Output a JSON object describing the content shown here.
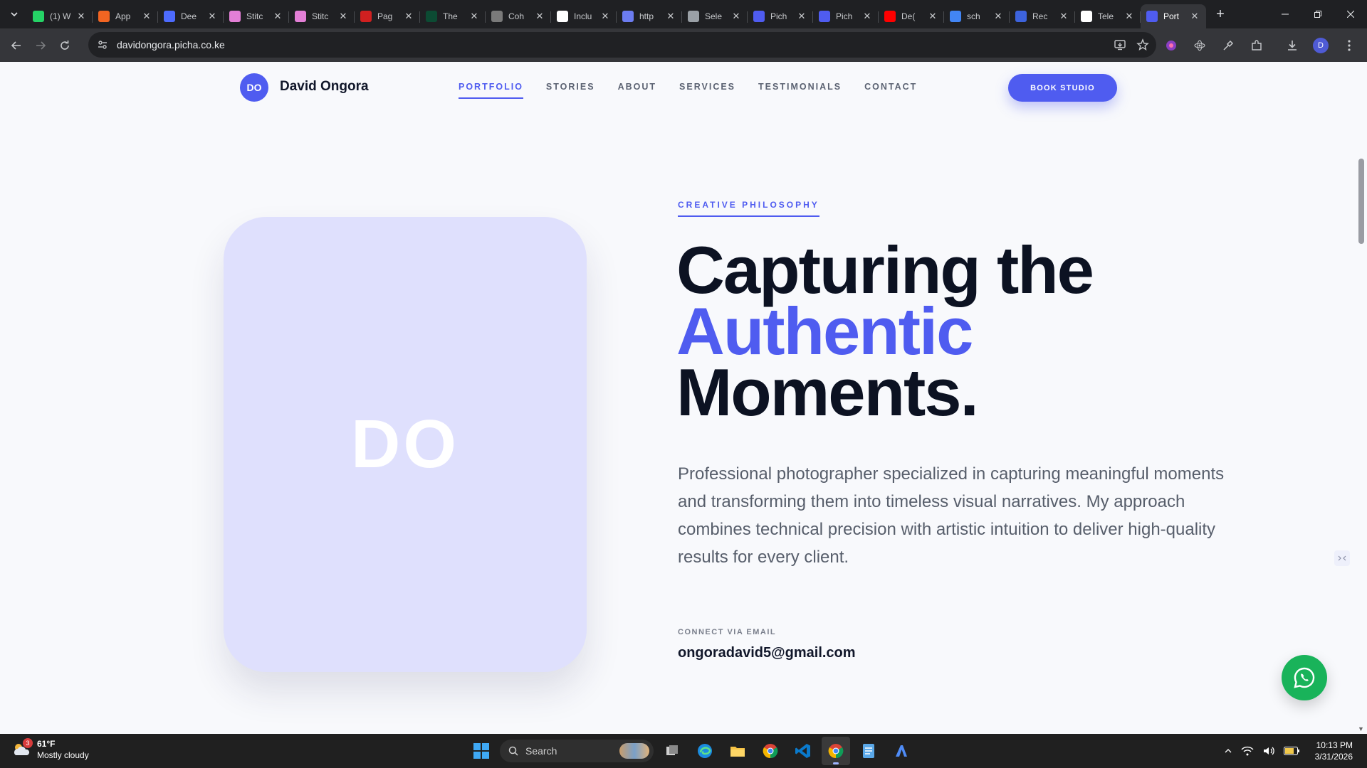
{
  "browser": {
    "tabs": [
      {
        "title": "(1) W",
        "favicon": "whatsapp-icon",
        "color": "#25d366"
      },
      {
        "title": "App",
        "favicon": "ycombinator-icon",
        "color": "#f26522"
      },
      {
        "title": "Dee",
        "favicon": "deepseek-icon",
        "color": "#4d6bfe"
      },
      {
        "title": "Stitc",
        "favicon": "stitch-icon",
        "color": "#e37fd6"
      },
      {
        "title": "Stitc",
        "favicon": "stitch-icon",
        "color": "#e37fd6"
      },
      {
        "title": "Pag",
        "favicon": "page-icon",
        "color": "#d02020"
      },
      {
        "title": "The",
        "favicon": "django-icon",
        "color": "#0c4b33"
      },
      {
        "title": "Coh",
        "favicon": "dot-icon",
        "color": "#7a7a7a"
      },
      {
        "title": "Inclu",
        "favicon": "wb-icon",
        "color": "#ffffff"
      },
      {
        "title": "http",
        "favicon": "link-icon",
        "color": "#6c7cf0"
      },
      {
        "title": "Sele",
        "favicon": "globe-icon",
        "color": "#9aa0a6"
      },
      {
        "title": "Pich",
        "favicon": "picha-icon",
        "color": "#4f5cf0"
      },
      {
        "title": "Pich",
        "favicon": "picha-icon",
        "color": "#4f5cf0"
      },
      {
        "title": "De(",
        "favicon": "youtube-icon",
        "color": "#ff0000"
      },
      {
        "title": "sch",
        "favicon": "google-icon",
        "color": "#4285f4"
      },
      {
        "title": "Rec",
        "favicon": "recraft-icon",
        "color": "#3d63dd"
      },
      {
        "title": "Tele",
        "favicon": "github-icon",
        "color": "#ffffff"
      },
      {
        "title": "Port",
        "favicon": "portfolio-icon",
        "color": "#4f5cf0",
        "active": true
      }
    ],
    "url": "davidongora.picha.co.ke",
    "profile_initial": "D"
  },
  "site": {
    "logo_initials": "DO",
    "logo_name": "David Ongora",
    "nav": [
      "PORTFOLIO",
      "STORIES",
      "ABOUT",
      "SERVICES",
      "TESTIMONIALS",
      "CONTACT"
    ],
    "active_nav": "PORTFOLIO",
    "cta": "BOOK STUDIO"
  },
  "hero": {
    "card_initials": "DO",
    "card_color": "#dfe0fd",
    "eyebrow": "CREATIVE PHILOSOPHY",
    "headline_1": "Capturing the",
    "headline_accent": "Authentic",
    "headline_3": "Moments.",
    "accent_color": "#4f5cf0",
    "lead": "Professional photographer specialized in capturing meaningful moments and transforming them into timeless visual narratives. My approach combines technical precision with artistic intuition to deliver high-quality results for every client.",
    "email_label": "CONNECT VIA EMAIL",
    "email": "ongoradavid5@gmail.com"
  },
  "taskbar": {
    "weather_temp": "61°F",
    "weather_desc": "Mostly cloudy",
    "weather_badge": "3",
    "search_label": "Search",
    "time": "10:13 PM",
    "date": "3/31/2026"
  }
}
